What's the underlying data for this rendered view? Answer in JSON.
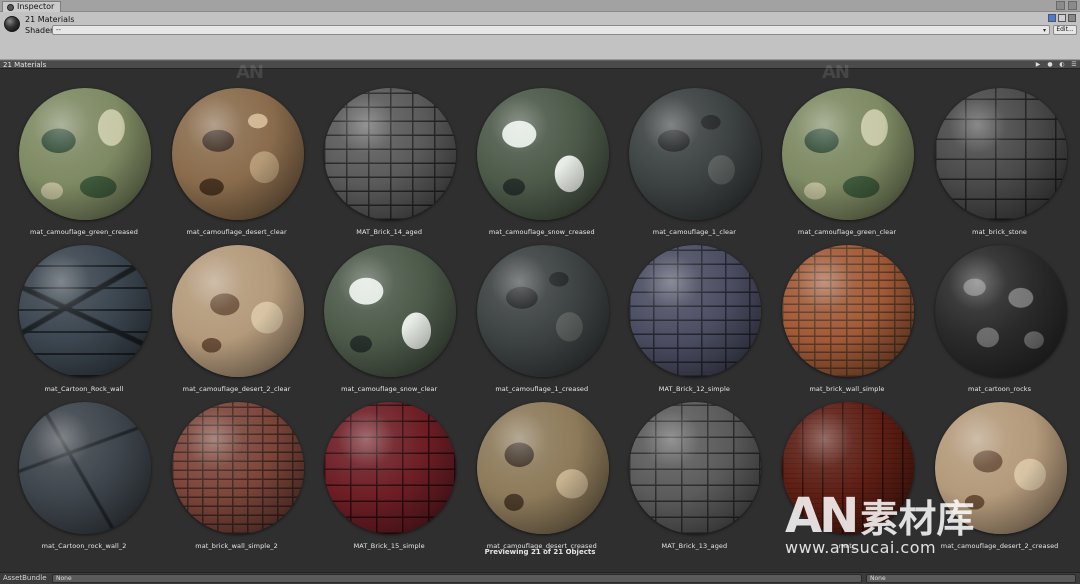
{
  "tab": {
    "label": "Inspector"
  },
  "header": {
    "title": "21 Materials",
    "shader_label": "Shader",
    "shader_value": "--",
    "edit_label": "Edit..."
  },
  "preview": {
    "title": "21 Materials",
    "status": "Previewing 21 of 21 Objects"
  },
  "materials": [
    {
      "name": "mat_camouflage_green_creased",
      "style": "m-cam-green"
    },
    {
      "name": "mat_camouflage_desert_clear",
      "style": "m-cam-desert"
    },
    {
      "name": "MAT_Brick_14_aged",
      "style": "m-brick-grey"
    },
    {
      "name": "mat_camouflage_snow_creased",
      "style": "m-cam-snow"
    },
    {
      "name": "mat_camouflage_1_clear",
      "style": "m-cam-dark"
    },
    {
      "name": "mat_camouflage_green_clear",
      "style": "m-cam-green"
    },
    {
      "name": "mat_brick_stone",
      "style": "m-brick-stone"
    },
    {
      "name": "mat_Cartoon_Rock_wall",
      "style": "m-cartoon-rock"
    },
    {
      "name": "mat_camouflage_desert_2_clear",
      "style": "m-cam-desert2"
    },
    {
      "name": "mat_camouflage_snow_clear",
      "style": "m-cam-snow"
    },
    {
      "name": "mat_camouflage_1_creased",
      "style": "m-cam-dark"
    },
    {
      "name": "MAT_Brick_12_simple",
      "style": "m-brick-blue"
    },
    {
      "name": "mat_brick_wall_simple",
      "style": "m-brick-orange"
    },
    {
      "name": "mat_cartoon_rocks",
      "style": "m-rocks"
    },
    {
      "name": "mat_Cartoon_rock_wall_2",
      "style": "m-cartoon-rock2"
    },
    {
      "name": "mat_brick_wall_simple_2",
      "style": "m-brick-red"
    },
    {
      "name": "MAT_Brick_15_simple",
      "style": "m-brick-crimson"
    },
    {
      "name": "mat_camouflage_desert_creased",
      "style": "m-cam-desert-c"
    },
    {
      "name": "MAT_Brick_13_aged",
      "style": "m-brick-slate"
    },
    {
      "name": "mat_",
      "style": "m-wood"
    },
    {
      "name": "mat_camouflage_desert_2_creased",
      "style": "m-cam-desert2"
    }
  ],
  "footer": {
    "assetbundle_label": "AssetBundle",
    "assetbundle_value": "None",
    "variant_value": "None"
  },
  "watermark": {
    "logo": "AN",
    "cn": "素材库",
    "url": "www.ansucai.com"
  }
}
